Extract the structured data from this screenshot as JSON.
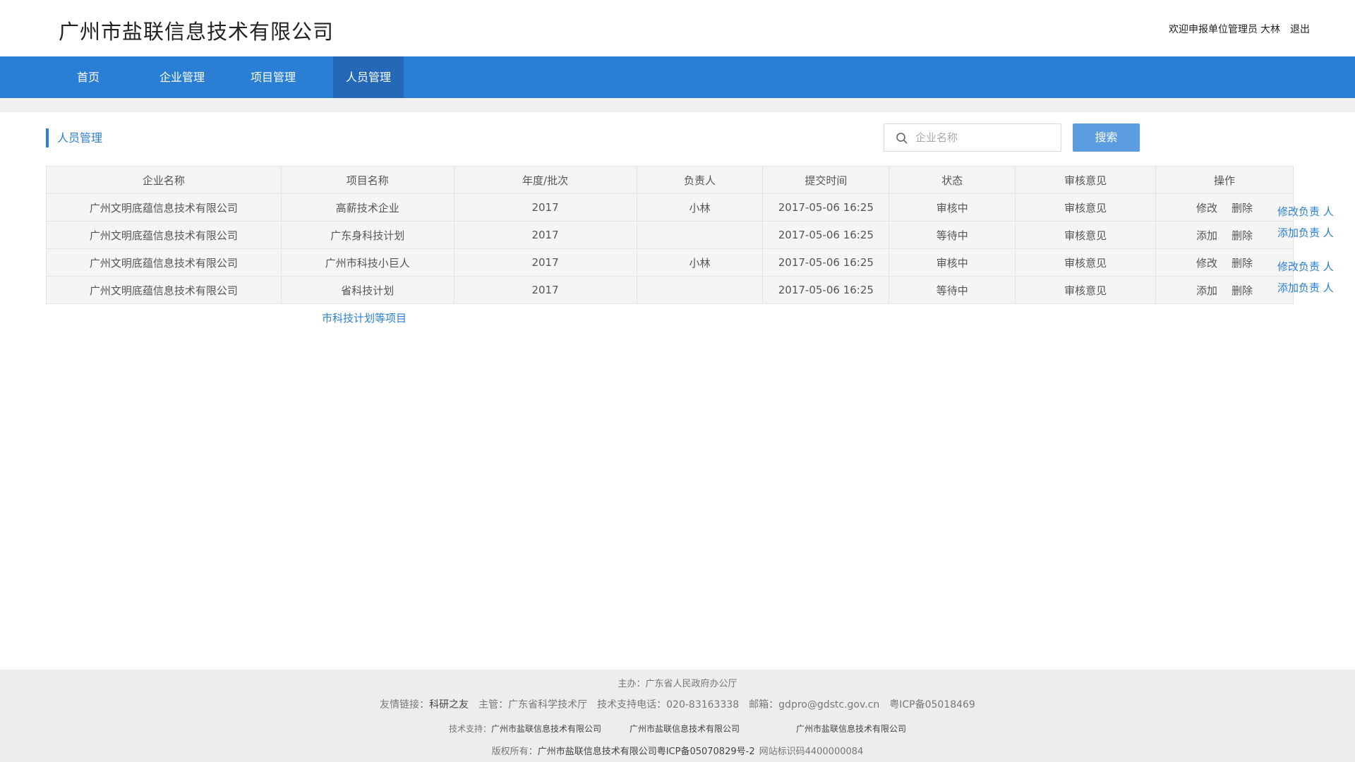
{
  "header": {
    "site_title": "广州市盐联信息技术有限公司",
    "welcome": "欢迎申报单位管理员",
    "user": "大林",
    "logout": "退出"
  },
  "nav": {
    "items": [
      {
        "label": "首页"
      },
      {
        "label": "企业管理"
      },
      {
        "label": "项目管理"
      },
      {
        "label": "人员管理"
      }
    ],
    "active": "人员管理"
  },
  "section": {
    "title": "人员管理"
  },
  "search": {
    "placeholder": "企业名称",
    "value": "",
    "button": "搜索"
  },
  "table": {
    "columns": [
      "企业名称",
      "项目名称",
      "年度/批次",
      "负责人",
      "提交时间",
      "状态",
      "审核意见",
      "操作"
    ],
    "rows": [
      {
        "company": "广州文明底蕴信息技术有限公司",
        "project": "高薪技术企业",
        "year": "2017",
        "owner": "小林",
        "time": "2017-05-06 16:25",
        "status": "审核中",
        "review": "审核意见",
        "op1": "修改",
        "op2": "删除",
        "extra": "修改负责 人"
      },
      {
        "company": "广州文明底蕴信息技术有限公司",
        "project": "广东身科技计划",
        "year": "2017",
        "owner": "",
        "time": "2017-05-06 16:25",
        "status": "等待中",
        "review": "审核意见",
        "op1": "添加",
        "op2": "删除",
        "extra": "添加负责 人"
      },
      {
        "company": "广州文明底蕴信息技术有限公司",
        "project": "广州市科技小巨人",
        "year": "2017",
        "owner": "小林",
        "time": "2017-05-06 16:25",
        "status": "审核中",
        "review": "审核意见",
        "op1": "修改",
        "op2": "删除",
        "extra": "修改负责 人"
      },
      {
        "company": "广州文明底蕴信息技术有限公司",
        "project": "省科技计划",
        "year": "2017",
        "owner": "",
        "time": "2017-05-06 16:25",
        "status": "等待中",
        "review": "审核意见",
        "op1": "添加",
        "op2": "删除",
        "extra": "添加负责 人"
      }
    ],
    "more_link": "市科技计划等项目"
  },
  "footer": {
    "host": "主办：广东省人民政府办公厅",
    "links_label": "友情链接：",
    "links_value": "科研之友",
    "supervisor": "主管：广东省科学技术厅",
    "phone": "技术支持电话：020-83163338",
    "email": "邮箱：gdpro@gdstc.gov.cn",
    "icp": "粤ICP备05018469",
    "support_label": "技术支持：",
    "support_1": "广州市盐联信息技术有限公司",
    "support_2": "广州市盐联信息技术有限公司",
    "support_3": "广州市盐联信息技术有限公司",
    "copyright_label": "版权所有：",
    "copyright_value": "广州市盐联信息技术有限公司",
    "copyright_icp": "粤ICP备05070829号-2",
    "site_id": "网站标识码4400000084"
  },
  "colors": {
    "primary": "#2a7fd4",
    "nav_active": "#2369b7",
    "search_button": "#5b9de0",
    "footer_bg": "#ededed"
  }
}
